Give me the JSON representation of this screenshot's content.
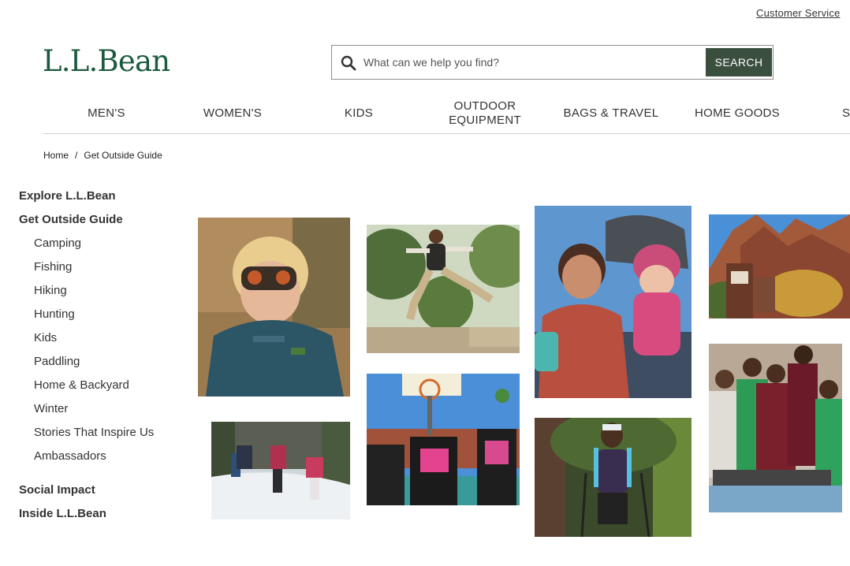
{
  "header": {
    "customer_service": "Customer Service",
    "logo": "L.L.Bean",
    "search_placeholder": "What can we help you find?",
    "search_button": "SEARCH"
  },
  "nav": {
    "items": [
      {
        "label": "MEN'S"
      },
      {
        "label": "WOMEN'S"
      },
      {
        "label": "KIDS"
      },
      {
        "label": "OUTDOOR\nEQUIPMENT"
      },
      {
        "label": "BAGS & TRAVEL"
      },
      {
        "label": "HOME GOODS"
      },
      {
        "label": "S"
      }
    ]
  },
  "breadcrumb": {
    "home": "Home",
    "separator": "/",
    "current": "Get Outside Guide"
  },
  "sidebar": {
    "explore": "Explore L.L.Bean",
    "guide": "Get Outside Guide",
    "sub_items": [
      "Camping",
      "Fishing",
      "Hiking",
      "Hunting",
      "Kids",
      "Paddling",
      "Home & Backyard",
      "Winter",
      "Stories That Inspire Us",
      "Ambassadors"
    ],
    "social_impact": "Social Impact",
    "inside": "Inside L.L.Bean"
  },
  "colors": {
    "brand_green": "#1b5a3f",
    "search_button": "#3b4f3f"
  },
  "photos": [
    {
      "subject": "child-binoculars"
    },
    {
      "subject": "girl-jumping"
    },
    {
      "subject": "mother-child-hiking"
    },
    {
      "subject": "zion-canyon-sign"
    },
    {
      "subject": "snow-family"
    },
    {
      "subject": "basketball-court-team"
    },
    {
      "subject": "trail-hiker"
    },
    {
      "subject": "group-jumping-court"
    }
  ]
}
